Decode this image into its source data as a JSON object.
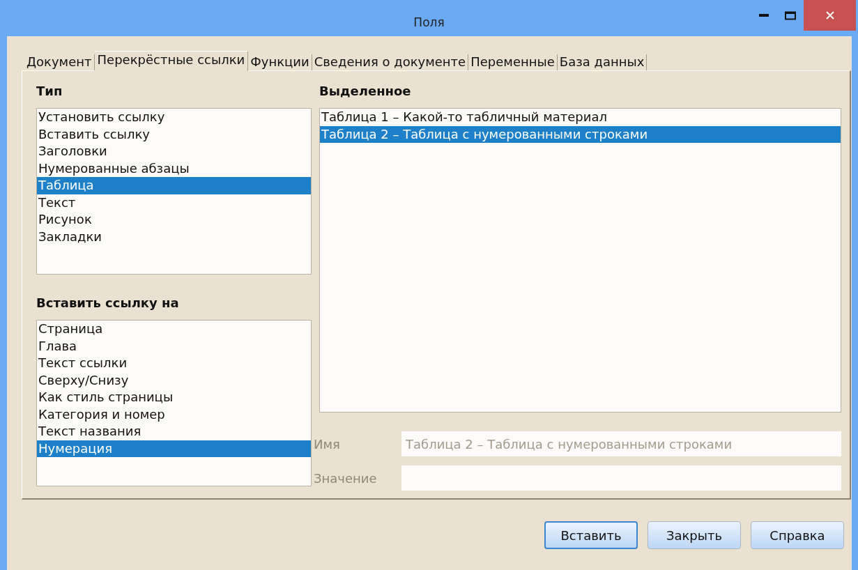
{
  "window": {
    "title": "Поля"
  },
  "tabs": [
    {
      "label": "Документ",
      "selected": false
    },
    {
      "label": "Перекрёстные ссылки",
      "selected": true
    },
    {
      "label": "Функции",
      "selected": false
    },
    {
      "label": "Сведения о документе",
      "selected": false
    },
    {
      "label": "Переменные",
      "selected": false
    },
    {
      "label": "База данных",
      "selected": false
    }
  ],
  "type_list": {
    "heading": "Тип",
    "items": [
      {
        "label": "Установить ссылку",
        "selected": false
      },
      {
        "label": "Вставить ссылку",
        "selected": false
      },
      {
        "label": "Заголовки",
        "selected": false
      },
      {
        "label": "Нумерованные абзацы",
        "selected": false
      },
      {
        "label": "Таблица",
        "selected": true
      },
      {
        "label": "Текст",
        "selected": false
      },
      {
        "label": "Рисунок",
        "selected": false
      },
      {
        "label": "Закладки",
        "selected": false
      }
    ]
  },
  "refer_list": {
    "heading": "Вставить ссылку на",
    "items": [
      {
        "label": "Страница",
        "selected": false
      },
      {
        "label": "Глава",
        "selected": false
      },
      {
        "label": "Текст ссылки",
        "selected": false
      },
      {
        "label": "Сверху/Снизу",
        "selected": false
      },
      {
        "label": "Как стиль страницы",
        "selected": false
      },
      {
        "label": "Категория и номер",
        "selected": false
      },
      {
        "label": "Текст названия",
        "selected": false
      },
      {
        "label": "Нумерация",
        "selected": true
      }
    ]
  },
  "selection_list": {
    "heading": "Выделенное",
    "items": [
      {
        "label": "Таблица 1 – Какой-то табличный материал",
        "selected": false
      },
      {
        "label": "Таблица 2 – Таблица с нумерованными строками",
        "selected": true
      }
    ]
  },
  "fields": [
    {
      "label": "Имя",
      "value": "Таблица 2 – Таблица с нумерованными строками",
      "disabled": true
    },
    {
      "label": "Значение",
      "disabled": true
    }
  ],
  "buttons": [
    {
      "label": "Вставить",
      "default": true
    },
    {
      "label": "Закрыть",
      "default": false
    },
    {
      "label": "Справка",
      "default": false
    }
  ]
}
